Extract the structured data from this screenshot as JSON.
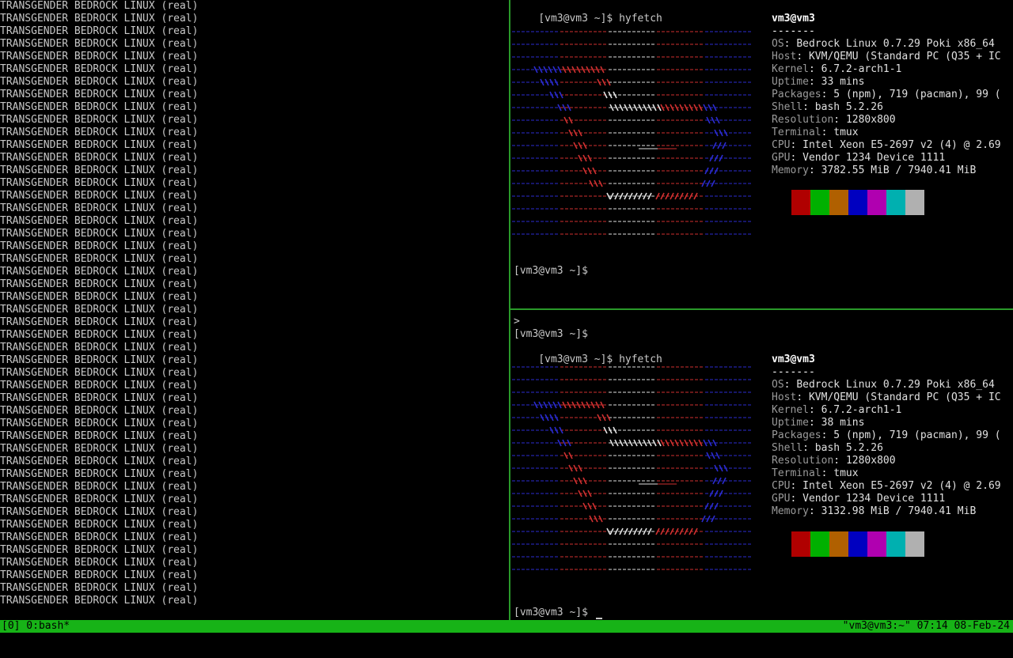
{
  "left_pane": {
    "repeat_text": "TRANSGENDER BEDROCK LINUX (real)",
    "repeat_count": 48
  },
  "top_pane": {
    "prompt": "[vm3@vm3 ~]$ ",
    "command": "hyfetch",
    "final_prompt": "[vm3@vm3 ~]$",
    "user_host": "vm3@vm3",
    "separator": "-------",
    "info": [
      {
        "key": "OS",
        "value": "Bedrock Linux 0.7.29 Poki x86_64"
      },
      {
        "key": "Host",
        "value": "KVM/QEMU (Standard PC (Q35 + IC"
      },
      {
        "key": "Kernel",
        "value": "6.7.2-arch1-1"
      },
      {
        "key": "Uptime",
        "value": "33 mins"
      },
      {
        "key": "Packages",
        "value": "5 (npm), 719 (pacman), 99 ("
      },
      {
        "key": "Shell",
        "value": "bash 5.2.26"
      },
      {
        "key": "Resolution",
        "value": "1280x800"
      },
      {
        "key": "Terminal",
        "value": "tmux"
      },
      {
        "key": "CPU",
        "value": "Intel Xeon E5-2697 v2 (4) @ 2.69"
      },
      {
        "key": "GPU",
        "value": "Vendor 1234 Device 1111"
      },
      {
        "key": "Memory",
        "value": "3782.55 MiB / 7940.41 MiB"
      }
    ]
  },
  "bottom_pane": {
    "line1": ">",
    "line2": "[vm3@vm3 ~]$",
    "prompt": "[vm3@vm3 ~]$ ",
    "command": "hyfetch",
    "final_prompt": "[vm3@vm3 ~]$ ",
    "user_host": "vm3@vm3",
    "separator": "-------",
    "info": [
      {
        "key": "OS",
        "value": "Bedrock Linux 0.7.29 Poki x86_64"
      },
      {
        "key": "Host",
        "value": "KVM/QEMU (Standard PC (Q35 + IC"
      },
      {
        "key": "Kernel",
        "value": "6.7.2-arch1-1"
      },
      {
        "key": "Uptime",
        "value": "38 mins"
      },
      {
        "key": "Packages",
        "value": "5 (npm), 719 (pacman), 99 ("
      },
      {
        "key": "Shell",
        "value": "bash 5.2.26"
      },
      {
        "key": "Resolution",
        "value": "1280x800"
      },
      {
        "key": "Terminal",
        "value": "tmux"
      },
      {
        "key": "CPU",
        "value": "Intel Xeon E5-2697 v2 (4) @ 2.69"
      },
      {
        "key": "GPU",
        "value": "Vendor 1234 Device 1111"
      },
      {
        "key": "Memory",
        "value": "3132.98 MiB / 7940.41 MiB"
      }
    ]
  },
  "palette": [
    "#000000",
    "#b00000",
    "#00b000",
    "#b06000",
    "#0000c0",
    "#b000b0",
    "#00b0b0",
    "#b0b0b0"
  ],
  "logo_colors": {
    "stripe_blue": "#2b2bd0",
    "stripe_red": "#d03030",
    "stripe_white": "#e0e0e0"
  },
  "status_bar": {
    "left": "[0] 0:bash*",
    "right": "\"vm3@vm3:~\" 07:14 08-Feb-24",
    "bg": "#17b317"
  }
}
